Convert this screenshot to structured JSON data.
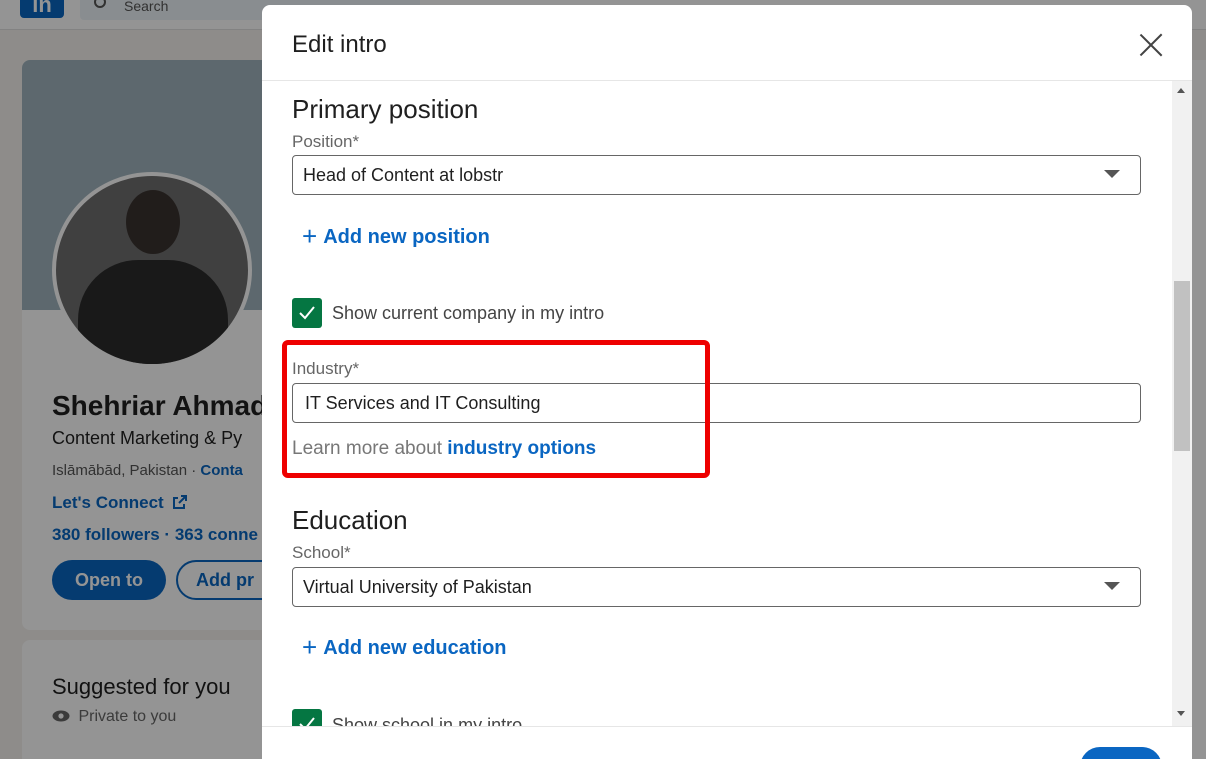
{
  "background": {
    "search_placeholder": "Search",
    "profile_name": "Shehriar Ahmad",
    "headline": "Content Marketing & Py",
    "location": "Islāmābād, Pakistan · ",
    "contact_link": "Conta",
    "website_link": "Let's Connect",
    "followers": "380 followers · 363 conne",
    "open_to_button": "Open to",
    "add_profile_button": "Add pr",
    "suggested_title": "Suggested for you",
    "private_label": "Private to you"
  },
  "modal": {
    "title": "Edit intro",
    "primary_position": {
      "section_title": "Primary position",
      "position_label": "Position*",
      "position_value": "Head of Content at lobstr",
      "add_position_label": "Add new position",
      "show_company_label": "Show current company in my intro",
      "show_company_checked": true
    },
    "industry": {
      "label": "Industry*",
      "value": "IT Services and IT Consulting",
      "learn_more_prefix": "Learn more about ",
      "learn_more_link": "industry options"
    },
    "education": {
      "section_title": "Education",
      "school_label": "School*",
      "school_value": "Virtual University of Pakistan",
      "add_education_label": "Add new education",
      "show_school_label": "Show school in my intro",
      "show_school_checked": true
    }
  },
  "colors": {
    "accent": "#0a66c2",
    "checkbox": "#057642",
    "highlight": "#ee0000"
  }
}
